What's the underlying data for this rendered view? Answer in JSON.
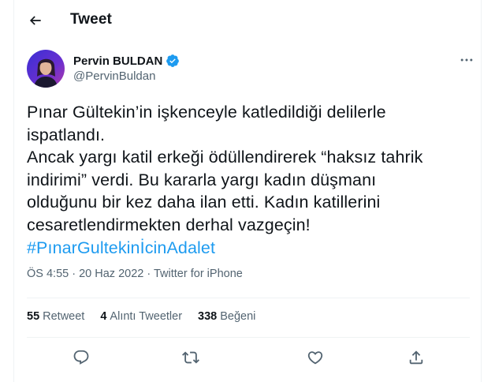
{
  "header": {
    "title": "Tweet"
  },
  "author": {
    "display_name": "Pervin BULDAN",
    "handle": "@PervinBuldan",
    "verified": true
  },
  "tweet": {
    "lines": [
      "Pınar Gültekin’in işkenceyle katledildiği delilerle",
      "ispatlandı.",
      "Ancak yargı katil erkeği ödüllendirerek “haksız tahrik",
      "indirimi” verdi. Bu kararla yargı kadın düşmanı",
      "olduğunu bir kez daha ilan etti. Kadın katillerini",
      "cesaretlendirmekten derhal vazgeçin!"
    ],
    "hashtag": "#PınarGultekinİcinAdalet"
  },
  "meta": {
    "time": "ÖS 4:55",
    "separator": "·",
    "date": "20 Haz 2022",
    "source": "Twitter for iPhone"
  },
  "stats": {
    "retweets": {
      "count": "55",
      "label": "Retweet"
    },
    "quotes": {
      "count": "4",
      "label": "Alıntı Tweetler"
    },
    "likes": {
      "count": "338",
      "label": "Beğeni"
    }
  },
  "icons": {
    "back": "arrow-left-icon",
    "verified": "verified-badge-icon",
    "more": "more-horizontal-icon",
    "reply": "reply-icon",
    "retweet": "retweet-icon",
    "like": "heart-icon",
    "share": "share-icon"
  },
  "colors": {
    "accent": "#1d9bf0",
    "text": "#0f1419",
    "secondary": "#536471",
    "border": "#eff3f4"
  }
}
